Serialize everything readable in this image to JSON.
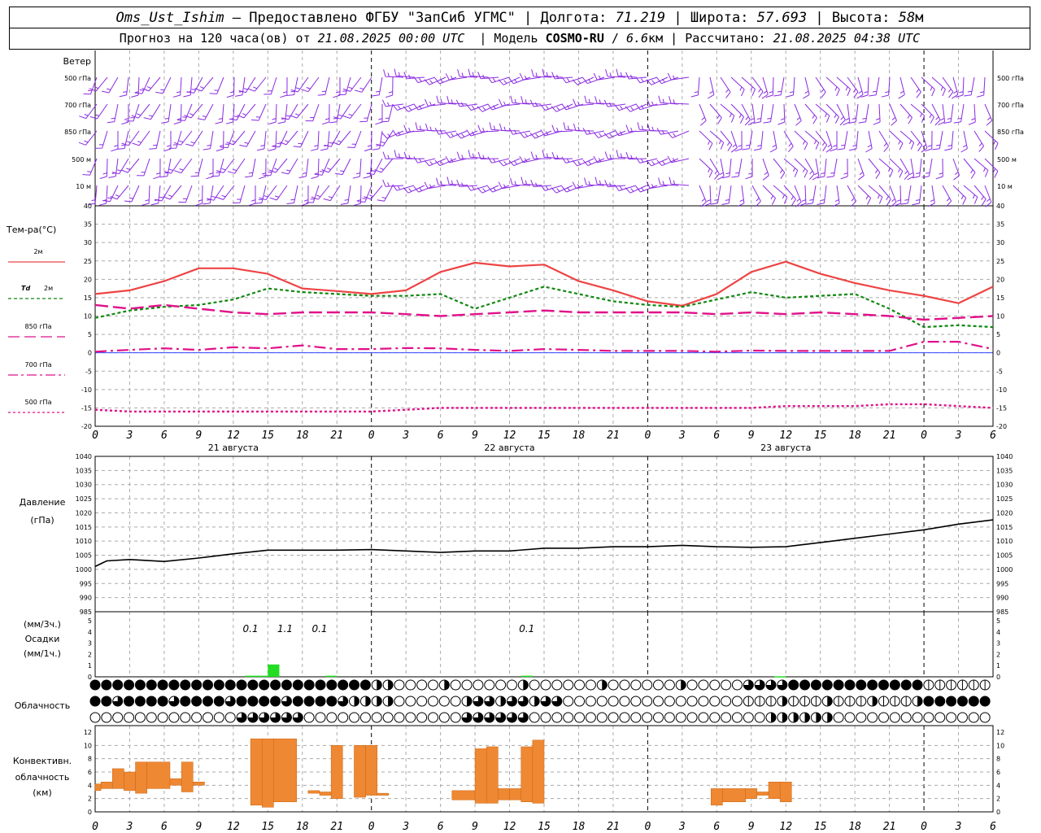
{
  "header": {
    "station": "Oms_Ust_Ishim",
    "sep1": "–",
    "provided": "Предоставлено ФГБУ \"ЗапСиб УГМС\"",
    "lon_label": "Долгота:",
    "lon_value": "71.219",
    "lat_label": "Широта:",
    "lat_value": "57.693",
    "alt_label": "Высота:",
    "alt_value": "58",
    "alt_unit": "м",
    "forecast_label": "Прогноз на 120 часа(ов) от",
    "forecast_time": "21.08.2025 00:00 UTC",
    "model_label": "Модель",
    "model_name": "COSMO-RU",
    "model_sep": "/",
    "model_res": "6.6",
    "model_res_unit": "км",
    "computed_label": "Рассчитано:",
    "computed_time": "21.08.2025 04:38 UTC"
  },
  "time_axis": {
    "hour_labels": [
      "0",
      "3",
      "6",
      "9",
      "12",
      "15",
      "18",
      "21",
      "0",
      "3",
      "6",
      "9",
      "12",
      "15",
      "18",
      "21",
      "0",
      "3",
      "6",
      "9",
      "12",
      "15",
      "18",
      "21",
      "0",
      "3",
      "6"
    ],
    "day_labels": [
      "21 августа",
      "22 августа",
      "23 августа"
    ]
  },
  "panels": {
    "wind": {
      "title": "Ветер",
      "levels": [
        "500 гПа",
        "700 гПа",
        "850 гПа",
        "500 м",
        "10  м"
      ],
      "color": "#8a2be2"
    },
    "temp": {
      "title": "Тем-ра(°С)",
      "legend": [
        {
          "label": "2м",
          "color": "#ee4444"
        },
        {
          "label_prefix": "Td",
          "label": "2м",
          "color": "#118811"
        },
        {
          "label": "850 гПа",
          "color": "#e0118a"
        },
        {
          "label": "700 гПа",
          "color": "#e0118a"
        },
        {
          "label": "500 гПа",
          "color": "#e0118a"
        }
      ],
      "y_ticks": [
        "40",
        "35",
        "30",
        "25",
        "20",
        "15",
        "10",
        "5",
        "0",
        "-5",
        "-10",
        "-15",
        "-20"
      ]
    },
    "pressure": {
      "title": "Давление",
      "unit": "(гПа)",
      "y_ticks": [
        "1040",
        "1035",
        "1030",
        "1025",
        "1020",
        "1015",
        "1010",
        "1005",
        "1000",
        "995",
        "990",
        "985"
      ]
    },
    "precip": {
      "unit_top": "(мм/3ч.)",
      "title": "Осадки",
      "unit_bottom": "(мм/1ч.)",
      "y_ticks": [
        "5",
        "4",
        "3",
        "2",
        "1",
        "0"
      ],
      "labels": [
        {
          "hour": 13.5,
          "text": "0.1"
        },
        {
          "hour": 16.5,
          "text": "1.1"
        },
        {
          "hour": 19.5,
          "text": "0.1"
        },
        {
          "hour": 37.5,
          "text": "0.1"
        }
      ]
    },
    "cloud": {
      "title": "Облачность"
    },
    "conv": {
      "title_l1": "Конвективн.",
      "title_l2": "облачность",
      "title_l3": "(км)",
      "y_ticks": [
        "12",
        "10",
        "8",
        "6",
        "4",
        "2",
        "0"
      ]
    }
  },
  "chart_data": [
    {
      "type": "line",
      "title": "Тем-ра(°С)",
      "ylim": [
        -20,
        40
      ],
      "x_hours": [
        0,
        3,
        6,
        9,
        12,
        15,
        18,
        21,
        24,
        27,
        30,
        33,
        36,
        39,
        42,
        45,
        48,
        51,
        54,
        57,
        60,
        63,
        66,
        69,
        72,
        75,
        78
      ],
      "series": [
        {
          "name": "2м",
          "values": [
            16,
            17,
            19.5,
            23,
            23,
            21.5,
            17.5,
            16.8,
            16,
            17,
            22,
            24.5,
            23.5,
            24,
            19.5,
            17,
            14,
            12.8,
            16,
            22,
            24.8,
            21.5,
            19,
            17,
            15.5,
            13.5,
            18
          ]
        },
        {
          "name": "Td 2м",
          "values": [
            9.5,
            11.5,
            12.5,
            13,
            14.5,
            17.5,
            16.5,
            16,
            15.5,
            15.5,
            16,
            12,
            15,
            18,
            16,
            14,
            13,
            12.5,
            14.5,
            16.5,
            15,
            15.5,
            16,
            12,
            7,
            7.5,
            7
          ]
        },
        {
          "name": "850 гПа",
          "values": [
            13,
            12,
            13,
            12,
            11,
            10.5,
            11,
            11,
            11,
            10.5,
            10,
            10.5,
            11,
            11.5,
            11,
            11,
            11,
            11,
            10.5,
            11,
            10.5,
            11,
            10.5,
            10,
            9,
            9.5,
            10
          ]
        },
        {
          "name": "700 гПа",
          "values": [
            0.3,
            0.8,
            1.2,
            0.8,
            1.5,
            1.2,
            2,
            1,
            1,
            1.3,
            1.2,
            0.8,
            0.5,
            1,
            0.8,
            0.5,
            0.5,
            0.5,
            0.3,
            0.6,
            0.5,
            0.5,
            0.5,
            0.5,
            3,
            3,
            1
          ]
        },
        {
          "name": "500 гПа",
          "values": [
            -15.5,
            -16,
            -16,
            -16,
            -16,
            -16,
            -16,
            -16,
            -16,
            -15.5,
            -15,
            -15,
            -15,
            -15,
            -15,
            -15,
            -15,
            -15,
            -15,
            -15,
            -14.5,
            -14.5,
            -14.5,
            -14,
            -14,
            -14.5,
            -15
          ]
        }
      ]
    },
    {
      "type": "line",
      "title": "Давление",
      "ylim": [
        985,
        1040
      ],
      "x_hours": [
        0,
        1,
        3,
        6,
        9,
        12,
        15,
        18,
        21,
        24,
        27,
        30,
        33,
        36,
        39,
        42,
        45,
        48,
        51,
        54,
        57,
        60,
        63,
        66,
        69,
        72,
        75,
        78
      ],
      "series": [
        {
          "name": "Давление",
          "values": [
            1001,
            1003,
            1003.5,
            1002.8,
            1004,
            1005.5,
            1006.8,
            1006.8,
            1006.8,
            1007,
            1006.5,
            1006,
            1006.5,
            1006.5,
            1007.5,
            1007.5,
            1008,
            1008,
            1008.5,
            1008,
            1007.8,
            1008,
            1009.5,
            1011,
            1012.5,
            1014,
            1016,
            1017.5
          ]
        }
      ]
    },
    {
      "type": "bar",
      "title": "Осадки",
      "ylim": [
        0,
        5
      ],
      "bars": [
        {
          "x0": 13,
          "x1": 15,
          "value": 0.1
        },
        {
          "x0": 15,
          "x1": 16,
          "value": 1.1
        },
        {
          "x0": 20,
          "x1": 21,
          "value": 0.1
        },
        {
          "x0": 37,
          "x1": 38,
          "value": 0.1
        },
        {
          "x0": 59,
          "x1": 60,
          "value": 0.05
        }
      ]
    },
    {
      "type": "bar",
      "title": "Конвективн. облачность (км)",
      "ylim": [
        0,
        13
      ],
      "bars": [
        {
          "x0": 0,
          "x1": 0.5,
          "bottom": 3.2,
          "top": 4.2
        },
        {
          "x0": 0.5,
          "x1": 1.5,
          "bottom": 3.5,
          "top": 4.5
        },
        {
          "x0": 1.5,
          "x1": 2.5,
          "bottom": 3.5,
          "top": 6.5
        },
        {
          "x0": 2.5,
          "x1": 3.5,
          "bottom": 3.2,
          "top": 6
        },
        {
          "x0": 3.5,
          "x1": 4.5,
          "bottom": 2.8,
          "top": 7.5
        },
        {
          "x0": 4.5,
          "x1": 6.5,
          "bottom": 3.5,
          "top": 7.5
        },
        {
          "x0": 6.5,
          "x1": 7.5,
          "bottom": 4,
          "top": 5
        },
        {
          "x0": 7.5,
          "x1": 8.5,
          "bottom": 3,
          "top": 7.5
        },
        {
          "x0": 8.5,
          "x1": 9.5,
          "bottom": 4,
          "top": 4.5
        },
        {
          "x0": 13.5,
          "x1": 14.5,
          "bottom": 1,
          "top": 11
        },
        {
          "x0": 14.5,
          "x1": 15.5,
          "bottom": 0.7,
          "top": 11
        },
        {
          "x0": 15.5,
          "x1": 17.5,
          "bottom": 1.5,
          "top": 11
        },
        {
          "x0": 18.5,
          "x1": 19.5,
          "bottom": 2.8,
          "top": 3.2
        },
        {
          "x0": 19.5,
          "x1": 20.5,
          "bottom": 2.5,
          "top": 3
        },
        {
          "x0": 20.5,
          "x1": 21.5,
          "bottom": 2,
          "top": 10
        },
        {
          "x0": 22.5,
          "x1": 23.5,
          "bottom": 2.2,
          "top": 10
        },
        {
          "x0": 23.5,
          "x1": 24.5,
          "bottom": 2.5,
          "top": 10
        },
        {
          "x0": 24.5,
          "x1": 25.5,
          "bottom": 2.5,
          "top": 2.8
        },
        {
          "x0": 31,
          "x1": 33,
          "bottom": 1.8,
          "top": 3.2
        },
        {
          "x0": 33,
          "x1": 34,
          "bottom": 1.3,
          "top": 9.5
        },
        {
          "x0": 34,
          "x1": 35,
          "bottom": 1.3,
          "top": 9.8
        },
        {
          "x0": 35,
          "x1": 36,
          "bottom": 1.8,
          "top": 3.5
        },
        {
          "x0": 36,
          "x1": 37,
          "bottom": 1.8,
          "top": 3.5
        },
        {
          "x0": 37,
          "x1": 38,
          "bottom": 1.5,
          "top": 9.8
        },
        {
          "x0": 38,
          "x1": 39,
          "bottom": 1.3,
          "top": 10.8
        },
        {
          "x0": 53.5,
          "x1": 54.5,
          "bottom": 1,
          "top": 3.5
        },
        {
          "x0": 54.5,
          "x1": 56.5,
          "bottom": 1.5,
          "top": 3.5
        },
        {
          "x0": 56.5,
          "x1": 57.5,
          "bottom": 2,
          "top": 3.5
        },
        {
          "x0": 57.5,
          "x1": 58.5,
          "bottom": 2.5,
          "top": 3
        },
        {
          "x0": 58.5,
          "x1": 59.5,
          "bottom": 2,
          "top": 4.5
        },
        {
          "x0": 59.5,
          "x1": 60.5,
          "bottom": 1.5,
          "top": 4.5
        }
      ]
    }
  ]
}
